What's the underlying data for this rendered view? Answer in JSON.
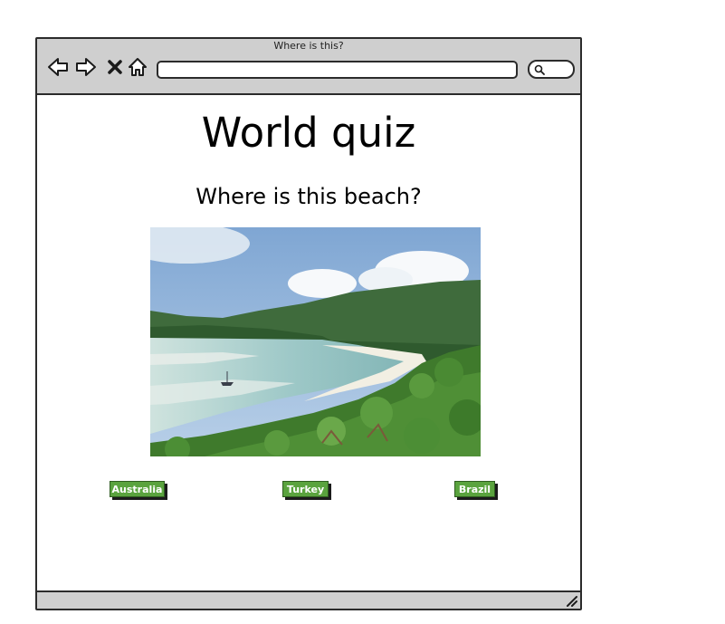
{
  "browser": {
    "title": "Where is this?",
    "icons": [
      "back-arrow-icon",
      "forward-arrow-icon",
      "stop-icon",
      "home-icon",
      "search-icon",
      "resize-grip-icon"
    ]
  },
  "page": {
    "title": "World quiz",
    "question": "Where is this beach?"
  },
  "answers": [
    {
      "label": "Australia"
    },
    {
      "label": "Turkey"
    },
    {
      "label": "Brazil"
    }
  ],
  "colors": {
    "button": "#5aa33e",
    "chrome": "#cfcfcf",
    "border": "#2b2b2b"
  }
}
